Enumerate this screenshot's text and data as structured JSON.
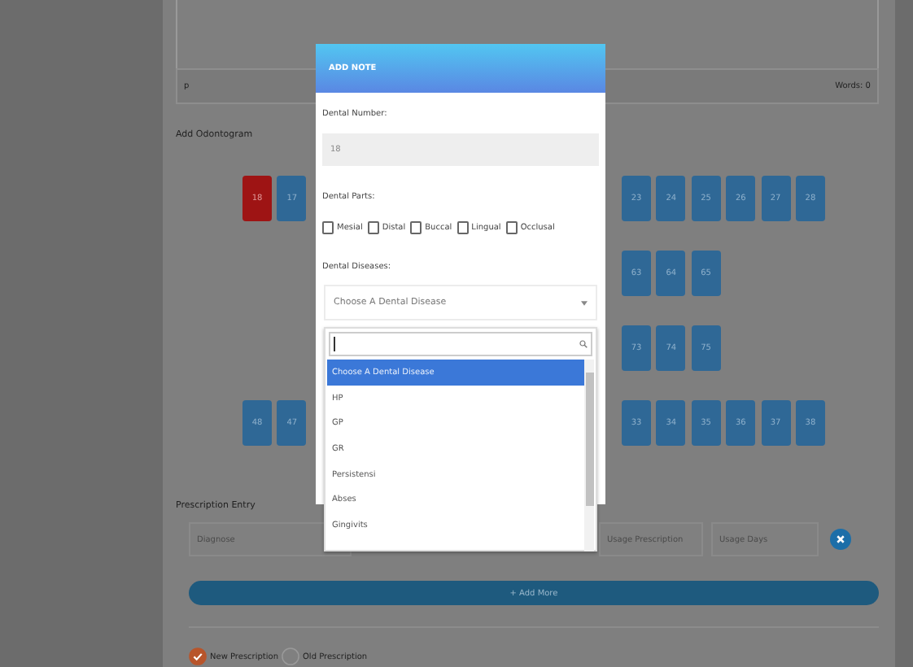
{
  "editor": {
    "path": "p",
    "word_count": "Words: 0"
  },
  "odontogram": {
    "title": "Add Odontogram",
    "rows": [
      {
        "left": [
          {
            "number": "18",
            "selected": true
          },
          {
            "number": "17",
            "selected": false
          }
        ],
        "right": [
          {
            "number": "23",
            "selected": false
          },
          {
            "number": "24",
            "selected": false
          },
          {
            "number": "25",
            "selected": false
          },
          {
            "number": "26",
            "selected": false
          },
          {
            "number": "27",
            "selected": false
          },
          {
            "number": "28",
            "selected": false
          }
        ]
      },
      {
        "left": [],
        "right": [
          {
            "number": "63",
            "selected": false
          },
          {
            "number": "64",
            "selected": false
          },
          {
            "number": "65",
            "selected": false
          }
        ]
      },
      {
        "left": [],
        "right": [
          {
            "number": "73",
            "selected": false
          },
          {
            "number": "74",
            "selected": false
          },
          {
            "number": "75",
            "selected": false
          }
        ]
      },
      {
        "left": [
          {
            "number": "48",
            "selected": false
          },
          {
            "number": "47",
            "selected": false
          }
        ],
        "right": [
          {
            "number": "33",
            "selected": false
          },
          {
            "number": "34",
            "selected": false
          },
          {
            "number": "35",
            "selected": false
          },
          {
            "number": "36",
            "selected": false
          },
          {
            "number": "37",
            "selected": false
          },
          {
            "number": "38",
            "selected": false
          }
        ]
      }
    ]
  },
  "prescription": {
    "title": "Prescription Entry",
    "fields": [
      {
        "placeholder": "Diagnose"
      },
      {
        "placeholder": "Usage Prescription"
      },
      {
        "placeholder": "Usage Days"
      }
    ],
    "add_button": "+ Add More",
    "types": [
      {
        "label": "New Prescription",
        "selected": true
      },
      {
        "label": "Old Prescription",
        "selected": false
      }
    ]
  },
  "modal": {
    "title": "ADD NOTE",
    "dental_number_label": "Dental Number:",
    "dental_number": "18",
    "parts_label": "Dental Parts:",
    "parts": [
      {
        "label": "Mesial",
        "checked": false
      },
      {
        "label": "Distal",
        "checked": false
      },
      {
        "label": "Buccal",
        "checked": false
      },
      {
        "label": "Lingual",
        "checked": false
      },
      {
        "label": "Occlusal",
        "checked": false
      }
    ],
    "diseases_label": "Dental Diseases:",
    "disease_select": "Choose A Dental Disease",
    "dropdown": {
      "options": [
        {
          "label": "Choose A Dental Disease",
          "selected": true
        },
        {
          "label": "HP",
          "selected": false
        },
        {
          "label": "GP",
          "selected": false
        },
        {
          "label": "GR",
          "selected": false
        },
        {
          "label": "Persistensi",
          "selected": false
        },
        {
          "label": "Abses",
          "selected": false
        },
        {
          "label": "Gingivits",
          "selected": false
        }
      ]
    }
  }
}
